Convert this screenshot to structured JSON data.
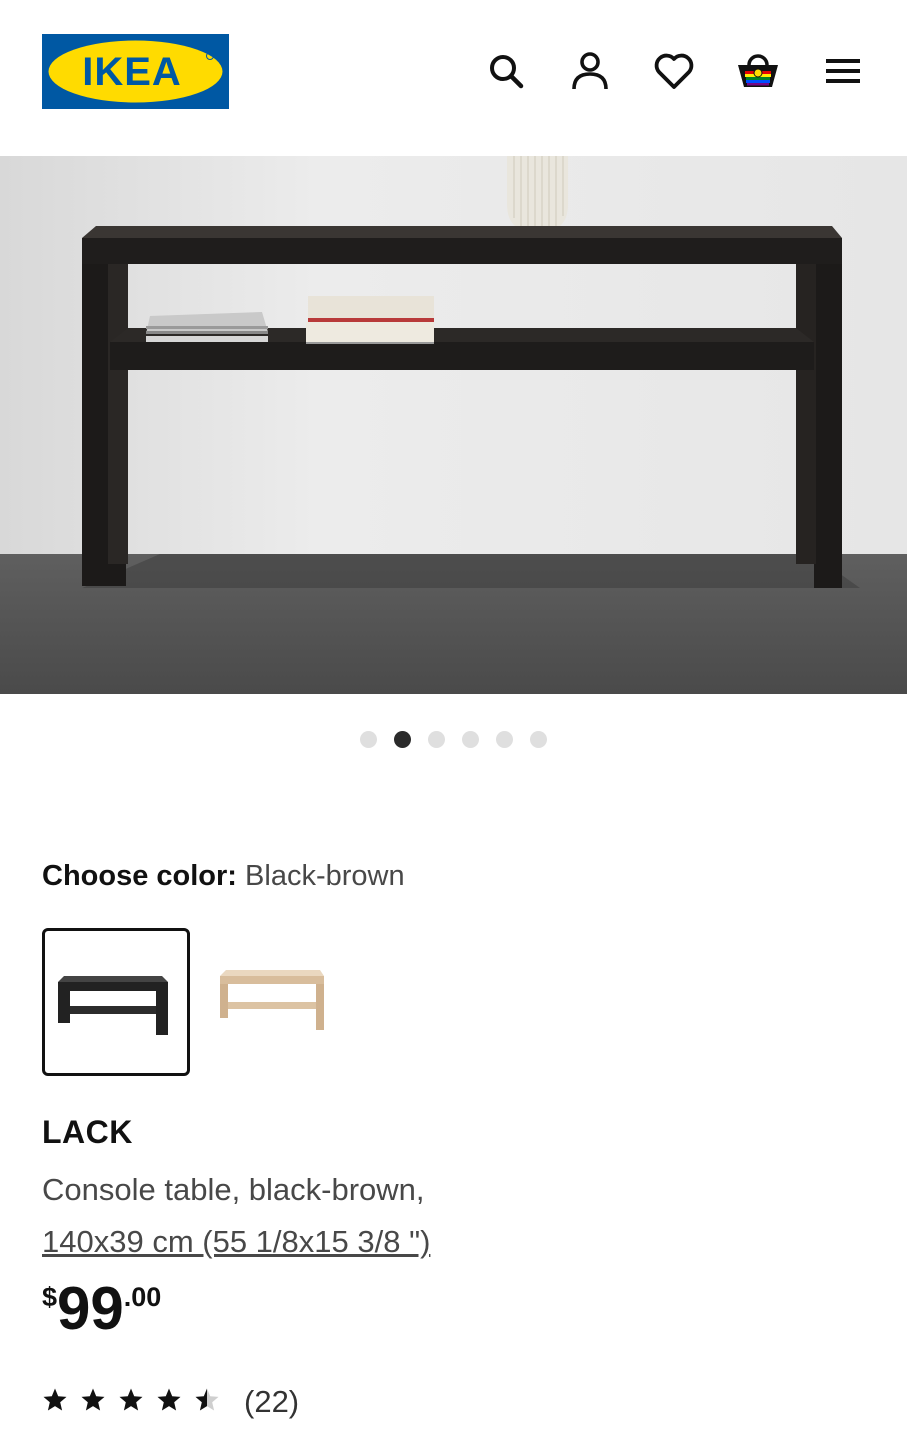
{
  "header": {
    "logo_text": "IKEA",
    "icons": [
      "search-icon",
      "user-icon",
      "heart-icon",
      "cart-icon",
      "menu-icon"
    ]
  },
  "gallery": {
    "image_count": 6,
    "active_index": 1
  },
  "color_picker": {
    "label": "Choose color:",
    "selected_value": "Black-brown",
    "options": [
      "black-brown",
      "white stained oak effect"
    ]
  },
  "product": {
    "name": "LACK",
    "description": "Console table, black-brown,",
    "measurement": "140x39 cm (55 1/8x15 3/8 \")",
    "price": {
      "currency": "$",
      "integer": "99",
      "decimal": ".00"
    },
    "rating": {
      "value": 4.5,
      "max": 5,
      "count_text": "(22)"
    }
  },
  "colors": {
    "ikea_blue": "#0058A3",
    "ikea_yellow": "#FFDB00",
    "text_primary": "#111111",
    "text_secondary": "#484848",
    "dot_active": "#2b2b2b",
    "dot_inactive": "#dfdfdf"
  }
}
